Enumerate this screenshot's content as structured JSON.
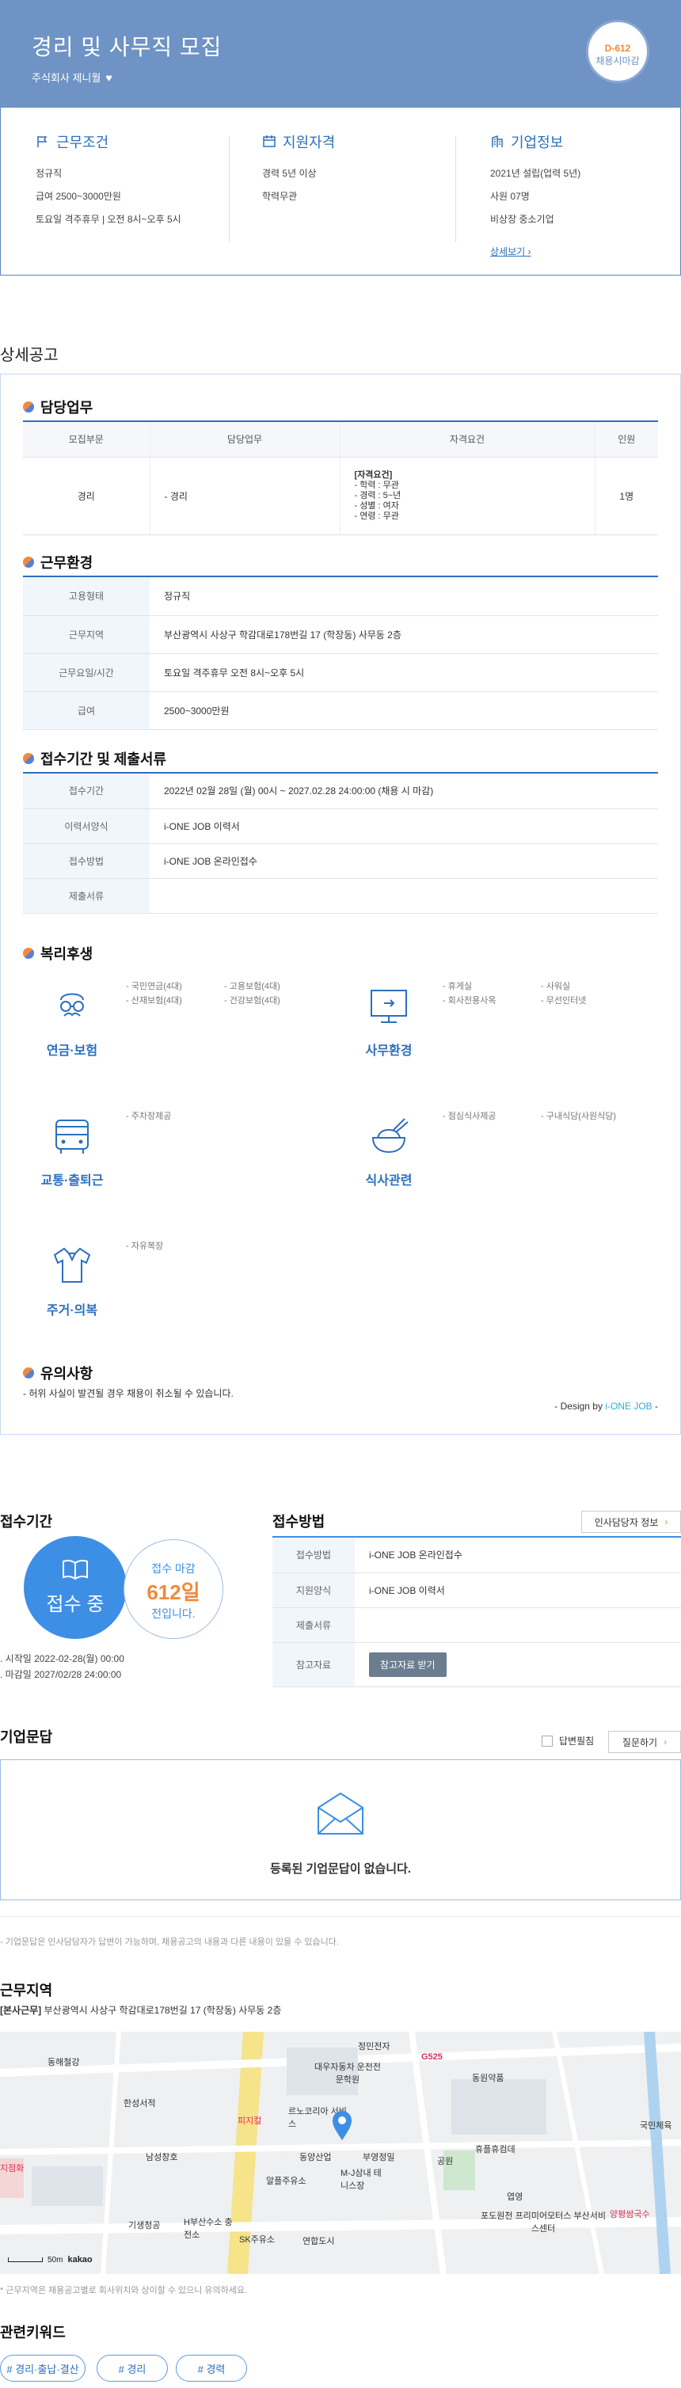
{
  "hero": {
    "title": "경리 및 사무직 모집",
    "company": "주식회사 제니월",
    "dday": "D-612",
    "dday_sub": "채용시마감"
  },
  "summary": {
    "work": {
      "title": "근무조건",
      "lines": [
        "정규직",
        "급여 2500~3000만원",
        "토요일 격주휴무 | 오전 8시~오후 5시"
      ]
    },
    "qual": {
      "title": "지원자격",
      "lines": [
        "경력 5년 이상",
        "학력무관"
      ]
    },
    "corp": {
      "title": "기업정보",
      "lines": [
        "2021년 설립(업력 5년)",
        "사원 07명",
        "비상장 중소기업"
      ],
      "link": "상세보기"
    }
  },
  "detail_title": "상세공고",
  "duty": {
    "title": "담당업무",
    "headers": [
      "모집부문",
      "담당업무",
      "자격요건",
      "인원"
    ],
    "row": {
      "dept": "경리",
      "task": "- 경리",
      "req_title": "[자격요건]",
      "req_lines": [
        "- 학력 : 무관",
        "- 경력 : 5~년",
        "- 성별 : 여자",
        "- 연령 : 무관"
      ],
      "count": "1명"
    }
  },
  "env": {
    "title": "근무환경",
    "rows": [
      {
        "k": "고용형태",
        "v": "정규직"
      },
      {
        "k": "근무지역",
        "v": "부산광역시 사상구 학감대로178번길 17 (학장동) 사무동 2층"
      },
      {
        "k": "근무요일/시간",
        "v": "토요일 격주휴무 오전 8시~오후 5시"
      },
      {
        "k": "급여",
        "v": "2500~3000만원"
      }
    ]
  },
  "apply": {
    "title": "접수기간 및 제출서류",
    "rows": [
      {
        "k": "접수기간",
        "v": "2022년 02월 28일 (월) 00시 ~ 2027.02.28 24:00:00 (채용 시 마감)"
      },
      {
        "k": "이력서양식",
        "v": "i-ONE JOB 이력서"
      },
      {
        "k": "접수방법",
        "v": "i-ONE JOB 온라인접수"
      },
      {
        "k": "제출서류",
        "v": ""
      }
    ]
  },
  "benefits": {
    "title": "복리후생",
    "groups": [
      {
        "label": "연금·보험",
        "icon": "glasses-mustache-icon",
        "items": [
          "- 국민연금(4대)",
          "- 고용보험(4대)",
          "- 산재보험(4대)",
          "- 건강보험(4대)"
        ]
      },
      {
        "label": "사무환경",
        "icon": "monitor-icon",
        "items": [
          "- 휴게실",
          "- 사워실",
          "- 회사전용사옥",
          "- 무선인터넷"
        ]
      },
      {
        "label": "교통·출퇴근",
        "icon": "bus-icon",
        "items": [
          "- 주차장제공"
        ]
      },
      {
        "label": "식사관련",
        "icon": "rice-bowl-icon",
        "items": [
          "- 점심식사제공",
          "- 구내식당(사원식당)"
        ]
      },
      {
        "label": "주거·의복",
        "icon": "shirt-icon",
        "items": [
          "- 자유복장"
        ]
      }
    ]
  },
  "notice": {
    "title": "유의사항",
    "text": "- 허위 사실이 발견될 경우 채용이 취소될 수 있습니다.",
    "design_by": "- Design by ",
    "brand": "i-ONE JOB",
    "brand_tail": " -"
  },
  "period": {
    "title": "접수기간",
    "status": "접수 중",
    "close_label": "접수 마감",
    "days": "612일",
    "left": "전입니다.",
    "start": "시작일 2022-02-28(월) 00:00",
    "end": "마감일 2027/02/28 24:00:00"
  },
  "method": {
    "title": "접수방법",
    "contact_btn": "인사담당자 정보",
    "rows": [
      {
        "k": "접수방법",
        "v": "i-ONE JOB 온라인접수"
      },
      {
        "k": "지원양식",
        "v": "i-ONE JOB 이력서"
      },
      {
        "k": "제출서류",
        "v": ""
      },
      {
        "k": "참고자료",
        "v": ""
      }
    ],
    "ref_btn": "참고자료 받기"
  },
  "qna": {
    "title": "기업문답",
    "check_label": "답변필침",
    "ask_btn": "질문하기",
    "empty": "등록된 기업문답이 없습니다.",
    "note": "- 기업문답은 인사담당자가 답변이 가능하며, 채용공고의 내용과 다른 내용이 있을 수 있습니다."
  },
  "location": {
    "title": "근무지역",
    "prefix": "[본사근무]",
    "address": "부산광역시 사상구 학감대로178번길 17 (학장동) 사무동 2층",
    "note": "* 근무지역은 채용공고별로 회사위치와 상이할 수 있으니 유의하세요.",
    "scale": "50m",
    "brand": "kakao",
    "places": [
      "정민전자",
      "G525",
      "동해철강",
      "대우자동차 운전전문학원",
      "동원약품",
      "한성서적",
      "피지컬",
      "르노코리아 서비스",
      "남성창호",
      "동양산업",
      "부영정밀",
      "휴플휴컴데",
      "국민체육",
      "알플주유소",
      "M-J삼내 테니스장",
      "공원",
      "엽영",
      "기생청공",
      "H부산수소 충전소",
      "SK주유소",
      "연합도시",
      "포도원천 프리미어모터스 부산서비스센터",
      "양평쌈국수",
      "사상구 국민체육"
    ]
  },
  "keywords": {
    "title": "관련키워드",
    "items": [
      "# 경리·출납·결산",
      "# 경리",
      "# 경력"
    ]
  },
  "colors": {
    "brand": "#6e93c4",
    "accent": "#2c6fbf",
    "orange": "#f08a3a",
    "pin": "#3c8fe5"
  }
}
